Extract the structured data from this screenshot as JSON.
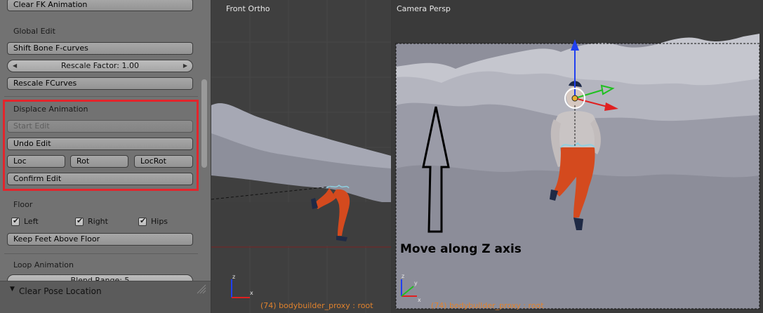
{
  "panel": {
    "clear_fk_button": "Clear FK Animation",
    "global_edit_title": "Global Edit",
    "shift_bone_button": "Shift Bone F-curves",
    "rescale_factor": "Rescale Factor: 1.00",
    "rescale_fcurves_button": "Rescale FCurves",
    "displace_title": "Displace Animation",
    "start_edit_button": "Start Edit",
    "undo_edit_button": "Undo Edit",
    "loc_button": "Loc",
    "rot_button": "Rot",
    "locrot_button": "LocRot",
    "confirm_edit_button": "Confirm Edit",
    "floor_title": "Floor",
    "floor_left": "Left",
    "floor_right": "Right",
    "floor_hips": "Hips",
    "keep_feet_button": "Keep Feet Above Floor",
    "loop_title": "Loop Animation",
    "blend_range": "Blend Range: 5",
    "footer_title": "Clear Pose Location",
    "highlight_color": "#e3252c"
  },
  "front_view": {
    "title": "Front Ortho",
    "status": "(74) bodybuilder_proxy : root"
  },
  "camera_view": {
    "title": "Camera Persp",
    "status": "(74) bodybuilder_proxy : root",
    "annotation": "Move along Z axis"
  },
  "colors": {
    "status_text": "#e0822d",
    "axis_x": "#e02020",
    "axis_y": "#20c020",
    "axis_z": "#2040f0"
  }
}
